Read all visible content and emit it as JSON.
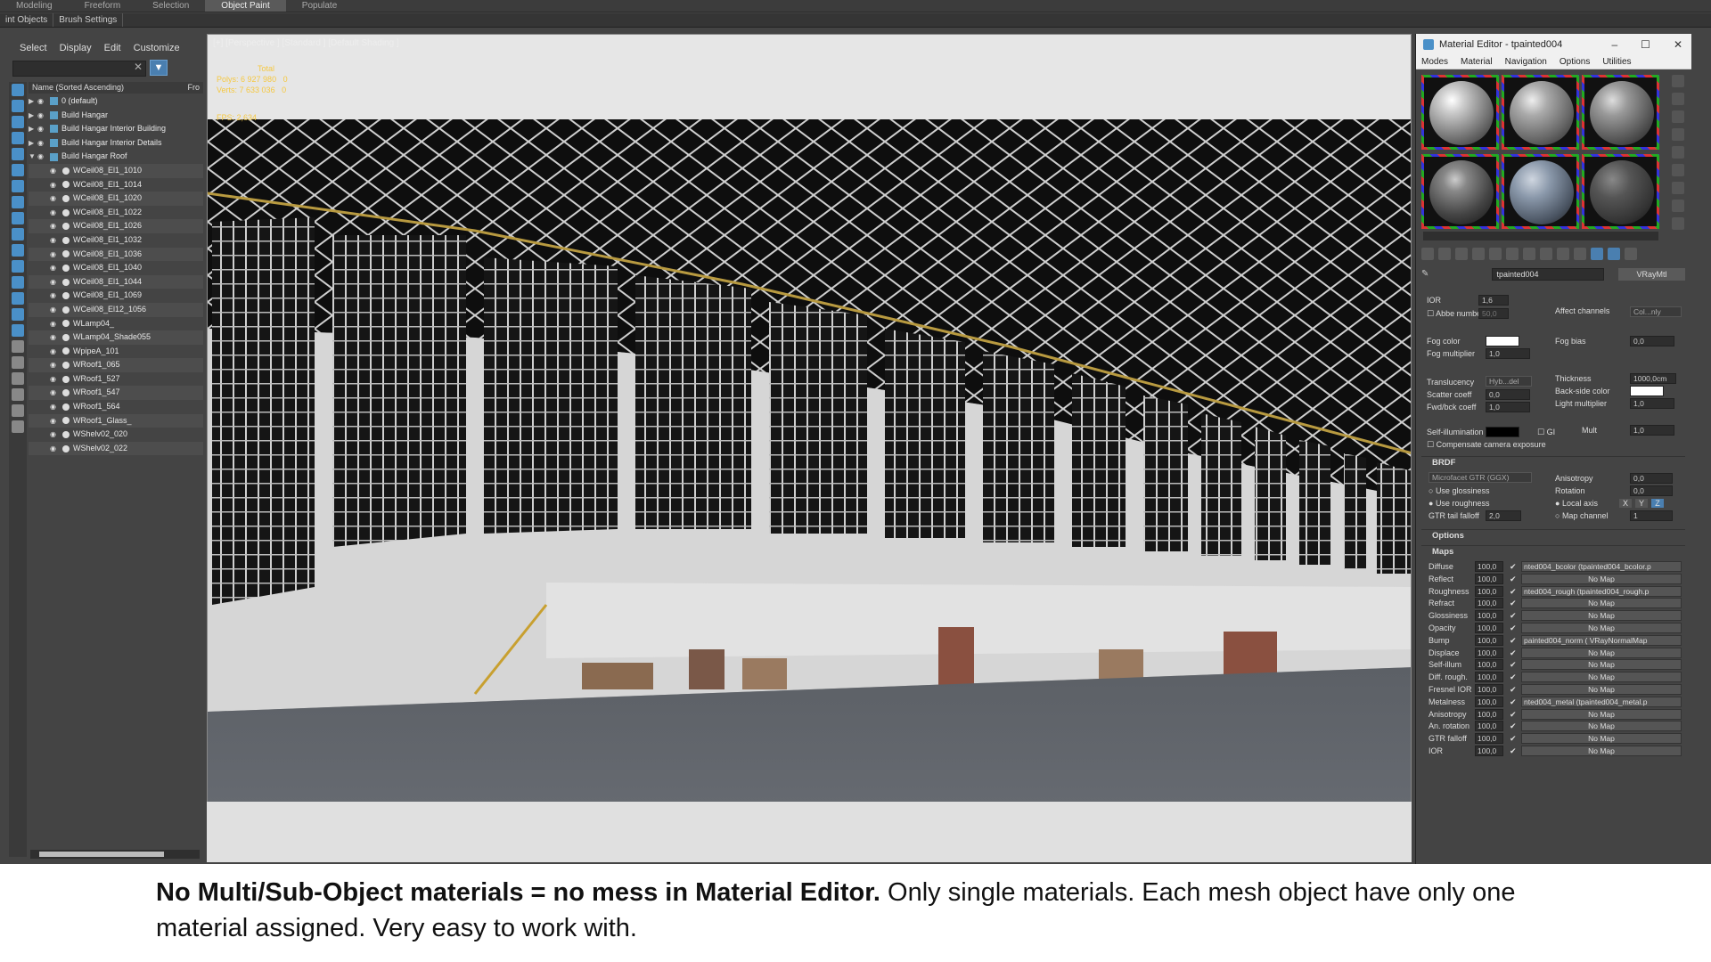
{
  "ribbon": {
    "tabs": [
      "Modeling",
      "Freeform",
      "Selection",
      "Object Paint",
      "Populate"
    ],
    "active": "Object Paint"
  },
  "subbar": {
    "items": [
      "int Objects",
      "Brush Settings"
    ]
  },
  "explorer": {
    "menu": [
      "Select",
      "Display",
      "Edit",
      "Customize"
    ],
    "column_name": "Name (Sorted Ascending)",
    "column_extra": "Fro",
    "layers": [
      {
        "label": "0 (default)",
        "expanded": false
      },
      {
        "label": "Build Hangar",
        "expanded": false
      },
      {
        "label": "Build Hangar Interior Building",
        "expanded": false
      },
      {
        "label": "Build Hangar Interior Details",
        "expanded": false
      },
      {
        "label": "Build Hangar Roof",
        "expanded": true
      }
    ],
    "objects": [
      "WCeil08_El1_1010",
      "WCeil08_El1_1014",
      "WCeil08_El1_1020",
      "WCeil08_El1_1022",
      "WCeil08_El1_1026",
      "WCeil08_El1_1032",
      "WCeil08_El1_1036",
      "WCeil08_El1_1040",
      "WCeil08_El1_1044",
      "WCeil08_El1_1069",
      "WCeil08_El12_1056",
      "WLamp04_",
      "WLamp04_Shade055",
      "WpipeA_101",
      "WRoof1_065",
      "WRoof1_527",
      "WRoof1_547",
      "WRoof1_564",
      "WRoof1_Glass_",
      "WShelv02_020",
      "WShelv02_022"
    ]
  },
  "viewport": {
    "label": "[+] [Perspective ] [Standard ] [Default Shading ]",
    "stats_total": "Total",
    "polys_label": "Polys:",
    "polys_value": "6 927 980",
    "polys_sel": "0",
    "verts_label": "Verts:",
    "verts_value": "7 633 036",
    "verts_sel": "0",
    "fps": "FPS:    2,634"
  },
  "material_editor": {
    "title": "Material Editor - tpainted004",
    "menu": [
      "Modes",
      "Material",
      "Navigation",
      "Options",
      "Utilities"
    ],
    "material_name": "tpainted004",
    "material_type": "VRayMtl",
    "params": {
      "ior_label": "IOR",
      "ior_value": "1,6",
      "abbe_label": "Abbe number",
      "abbe_value": "50,0",
      "affect_channels_label": "Affect channels",
      "affect_channels_value": "Col...nly",
      "fog_color_label": "Fog color",
      "fog_bias_label": "Fog bias",
      "fog_bias_value": "0,0",
      "fog_mult_label": "Fog multiplier",
      "fog_mult_value": "1,0",
      "translucency_label": "Translucency",
      "translucency_value": "Hyb...del",
      "thickness_label": "Thickness",
      "thickness_value": "1000,0cm",
      "scatter_label": "Scatter coeff",
      "scatter_value": "0,0",
      "backside_label": "Back-side color",
      "fwdbck_label": "Fwd/bck coeff",
      "fwdbck_value": "1,0",
      "light_mult_label": "Light multiplier",
      "light_mult_value": "1,0",
      "selfillum_label": "Self-illumination",
      "gi_label": "GI",
      "mult_label": "Mult",
      "mult_value": "1,0",
      "compensate_label": "Compensate camera exposure"
    },
    "brdf": {
      "title": "BRDF",
      "type": "Microfacet GTR (GGX)",
      "anisotropy_label": "Anisotropy",
      "anisotropy_value": "0,0",
      "use_glossiness": "Use glossiness",
      "rotation_label": "Rotation",
      "rotation_value": "0,0",
      "use_roughness": "Use roughness",
      "local_axis": "Local axis",
      "axes": [
        "X",
        "Y",
        "Z"
      ],
      "gtr_label": "GTR tail falloff",
      "gtr_value": "2,0",
      "map_channel_label": "Map channel",
      "map_channel_value": "1"
    },
    "options_title": "Options",
    "maps_title": "Maps",
    "maps": [
      {
        "label": "Diffuse",
        "value": "100,0",
        "map": "nted004_bcolor (tpainted004_bcolor.p",
        "named": true
      },
      {
        "label": "Reflect",
        "value": "100,0",
        "map": "No Map",
        "named": false
      },
      {
        "label": "Roughness",
        "value": "100,0",
        "map": "nted004_rough (tpainted004_rough.p",
        "named": true
      },
      {
        "label": "Refract",
        "value": "100,0",
        "map": "No Map",
        "named": false
      },
      {
        "label": "Glossiness",
        "value": "100,0",
        "map": "No Map",
        "named": false
      },
      {
        "label": "Opacity",
        "value": "100,0",
        "map": "No Map",
        "named": false
      },
      {
        "label": "Bump",
        "value": "100,0",
        "map": "painted004_norm  ( VRayNormalMap",
        "named": true
      },
      {
        "label": "Displace",
        "value": "100,0",
        "map": "No Map",
        "named": false
      },
      {
        "label": "Self-illum",
        "value": "100,0",
        "map": "No Map",
        "named": false
      },
      {
        "label": "Diff. rough.",
        "value": "100,0",
        "map": "No Map",
        "named": false
      },
      {
        "label": "Fresnel IOR",
        "value": "100,0",
        "map": "No Map",
        "named": false
      },
      {
        "label": "Metalness",
        "value": "100,0",
        "map": "nted004_metal (tpainted004_metal.p",
        "named": true
      },
      {
        "label": "Anisotropy",
        "value": "100,0",
        "map": "No Map",
        "named": false
      },
      {
        "label": "An. rotation",
        "value": "100,0",
        "map": "No Map",
        "named": false
      },
      {
        "label": "GTR falloff",
        "value": "100,0",
        "map": "No Map",
        "named": false
      },
      {
        "label": "IOR",
        "value": "100,0",
        "map": "No Map",
        "named": false
      }
    ]
  },
  "caption": {
    "bold": "No Multi/Sub-Object materials = no mess in Material Editor.",
    "normal": " Only single materials. Each mesh object have only one material assigned. Very easy to work with."
  },
  "colors": {
    "accent": "#4a7fb0",
    "stats": "#f5c842",
    "panel": "#444444"
  }
}
